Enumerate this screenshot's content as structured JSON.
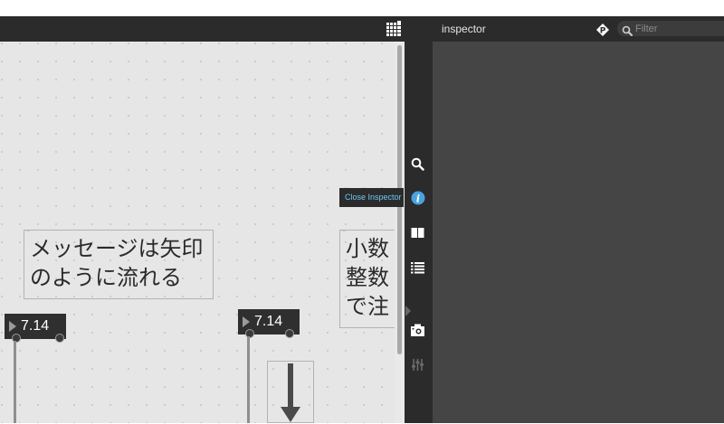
{
  "patcher": {
    "comments": [
      {
        "lines": [
          "メッセージは矢印",
          "のように流れる"
        ]
      },
      {
        "lines": [
          "小数",
          "整数",
          "で注"
        ]
      }
    ],
    "number_boxes": [
      {
        "value": "7.14"
      },
      {
        "value": "7.14"
      }
    ]
  },
  "sidebar": {
    "tooltip": "Close Inspector",
    "tools": [
      "search-icon",
      "info-icon",
      "book-icon",
      "list-icon",
      "camera-icon",
      "mixer-icon"
    ]
  },
  "inspector": {
    "title": "inspector",
    "filter_placeholder": "Filter"
  },
  "colors": {
    "canvas": "#e6e6e6",
    "toolbar": "#2b2b2b",
    "inspector_body": "#454545",
    "tooltip_text": "#6ec8f5",
    "info_icon": "#4aa3df"
  }
}
